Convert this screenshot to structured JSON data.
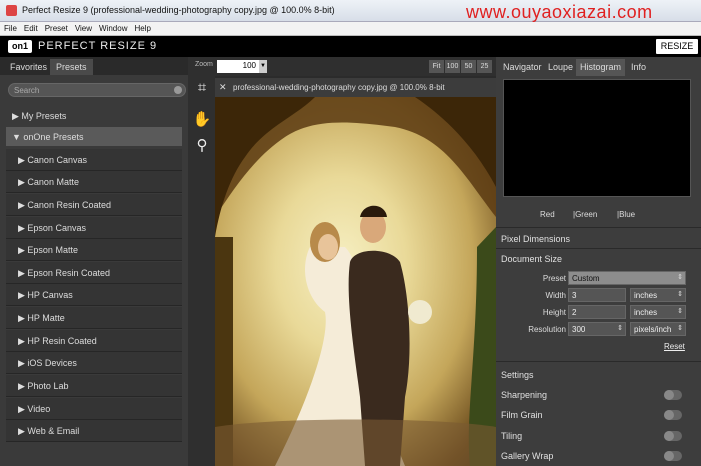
{
  "window": {
    "title": "Perfect Resize 9 (professional-wedding-photography copy.jpg @ 100.0% 8-bit)",
    "watermark": "www.ouyaoxiazai.com"
  },
  "menu": [
    "File",
    "Edit",
    "Preset",
    "View",
    "Window",
    "Help"
  ],
  "brand": {
    "logo": "on1",
    "product": "PERFECT RESIZE 9",
    "resize_button": "RESIZE"
  },
  "left": {
    "tabs": [
      "Favorites",
      "Presets"
    ],
    "search_placeholder": "Search",
    "sections": [
      "My Presets",
      "onOne Presets"
    ],
    "presets": [
      "Canon Canvas",
      "Canon Matte",
      "Canon Resin Coated",
      "Epson Canvas",
      "Epson Matte",
      "Epson Resin Coated",
      "HP Canvas",
      "HP Matte",
      "HP Resin Coated",
      "iOS Devices",
      "Photo Lab",
      "Video",
      "Web & Email"
    ]
  },
  "zoom": {
    "label": "Zoom",
    "value": "100",
    "buttons": [
      "Fit",
      "100",
      "50",
      "25"
    ]
  },
  "document_tab": "professional-wedding-photography copy.jpg @ 100.0% 8-bit",
  "right": {
    "tabs": [
      "Navigator",
      "Loupe",
      "Histogram",
      "Info"
    ],
    "channels": [
      "Red",
      "|Green",
      "|Blue"
    ],
    "pixel_dimensions": "Pixel Dimensions",
    "document_size": "Document Size",
    "fields": {
      "preset": {
        "label": "Preset",
        "value": "Custom"
      },
      "width": {
        "label": "Width",
        "value": "3",
        "unit": "inches"
      },
      "height": {
        "label": "Height",
        "value": "2",
        "unit": "inches"
      },
      "resolution": {
        "label": "Resolution",
        "value": "300",
        "unit": "pixels/inch"
      }
    },
    "reset": "Reset",
    "settings": {
      "title": "Settings",
      "items": [
        "Sharpening",
        "Film Grain",
        "Tiling",
        "Gallery Wrap"
      ]
    }
  },
  "colors": {
    "accent_red": "#e02020",
    "panel": "#3a3a3a",
    "dark": "#2b2b2b"
  }
}
